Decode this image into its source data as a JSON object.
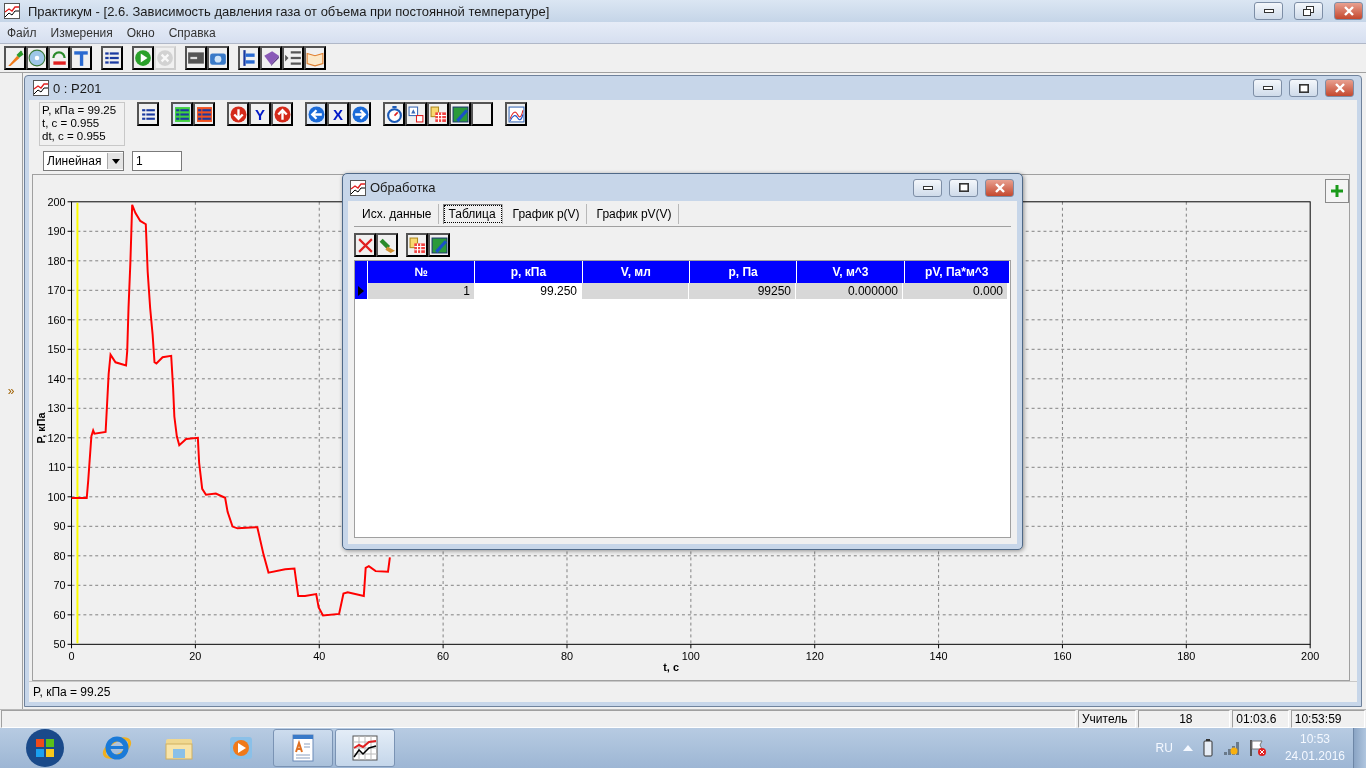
{
  "window": {
    "title": "Практикум - [2.6. Зависимость давления газа от объема при постоянной температуре]"
  },
  "menu": [
    "Файл",
    "Измерения",
    "Окно",
    "Справка"
  ],
  "toolbar": {
    "groups": [
      [
        {
          "kind": "carrot",
          "disabled": false
        },
        {
          "kind": "disc",
          "disabled": false
        },
        {
          "kind": "undo",
          "disabled": false
        },
        {
          "kind": "t-tool",
          "disabled": false
        }
      ],
      [
        {
          "kind": "list",
          "disabled": false
        }
      ],
      [
        {
          "kind": "play",
          "disabled": false
        },
        {
          "kind": "stop",
          "disabled": true
        }
      ],
      [
        {
          "kind": "console",
          "disabled": false
        },
        {
          "kind": "camera",
          "disabled": false
        }
      ],
      [
        {
          "kind": "tree",
          "disabled": false
        },
        {
          "kind": "book",
          "disabled": false
        },
        {
          "kind": "indent",
          "disabled": false
        },
        {
          "kind": "open-book",
          "disabled": false
        }
      ]
    ]
  },
  "side_strip": {
    "expander": "»"
  },
  "child_window": {
    "title": "0 : P201",
    "readings": [
      "P, кПа = 99.25",
      "t, с = 0.955",
      "dt, с = 0.955"
    ],
    "chart_toolbar": {
      "groups": [
        [
          {
            "kind": "list",
            "pressed": false
          }
        ],
        [
          {
            "kind": "checklist",
            "pressed": true
          },
          {
            "kind": "list-filled",
            "pressed": false
          }
        ],
        [
          {
            "kind": "arrow-down",
            "pressed": false
          },
          {
            "kind": "text",
            "label": "Y",
            "pressed": false
          },
          {
            "kind": "arrow-up",
            "pressed": false
          }
        ],
        [
          {
            "kind": "arrow-left",
            "pressed": true
          },
          {
            "kind": "text",
            "label": "X",
            "pressed": false
          },
          {
            "kind": "arrow-right",
            "pressed": false
          }
        ],
        [
          {
            "kind": "stopwatch",
            "pressed": false
          },
          {
            "kind": "image-swap",
            "pressed": false
          },
          {
            "kind": "table",
            "pressed": false
          },
          {
            "kind": "image-edit",
            "pressed": false
          },
          {
            "kind": "blank",
            "pressed": false
          }
        ],
        [
          {
            "kind": "chart",
            "pressed": false
          }
        ]
      ]
    },
    "scale_select": {
      "value": "Линейная"
    },
    "step_field": {
      "value": "1"
    },
    "chart_data": {
      "type": "line",
      "xlabel": "t, с",
      "ylabel": "P, кПа",
      "xlim": [
        0,
        200
      ],
      "ylim": [
        50,
        200
      ],
      "xticks": [
        0,
        20,
        40,
        60,
        80,
        100,
        120,
        140,
        160,
        180,
        200
      ],
      "yticks": [
        50,
        60,
        70,
        80,
        90,
        100,
        110,
        120,
        130,
        140,
        150,
        160,
        170,
        180,
        190,
        200
      ],
      "x": [
        0,
        2.45,
        2.7,
        3.2,
        3.5,
        3.7,
        5.5,
        5.8,
        6.0,
        6.3,
        7.1,
        8.8,
        9.0,
        9.2,
        9.5,
        9.8,
        10.3,
        11.1,
        12.0,
        12.3,
        12.7,
        13.1,
        13.4,
        13.7,
        14.7,
        16.1,
        16.4,
        16.6,
        17.0,
        17.4,
        18.5,
        20.4,
        20.6,
        21.1,
        21.7,
        23.3,
        24.8,
        25.2,
        26.0,
        26.8,
        30.0,
        31.0,
        31.8,
        34.5,
        36.0,
        36.6,
        37.7,
        39.5,
        39.9,
        40.6,
        43.2,
        43.9,
        44.6,
        47.2,
        47.5,
        48.0,
        49.1,
        51.1,
        51.4
      ],
      "series": [
        {
          "color": "#ff0000",
          "values": [
            99.6,
            99.6,
            105.5,
            120.5,
            122.5,
            121.4,
            122,
            134,
            141.7,
            148.2,
            145.6,
            144.5,
            149.5,
            164,
            179.6,
            199,
            196.3,
            193.5,
            192.4,
            176.3,
            164,
            155,
            145.6,
            145.2,
            147.3,
            147.8,
            137.2,
            127.2,
            120.5,
            117.5,
            119.6,
            120,
            111.5,
            102.7,
            100.7,
            101.1,
            99.7,
            94.9,
            89.9,
            89.3,
            89.7,
            80.4,
            74.3,
            75.4,
            75.7,
            66.4,
            66.4,
            67.0,
            62.5,
            59.8,
            60.3,
            67.2,
            67.6,
            66.4,
            75.9,
            76.5,
            74.8,
            74.6,
            79.5
          ]
        }
      ],
      "grid": true,
      "ref_lines": [
        {
          "axis": "x",
          "value": 0.955,
          "color": "#ffff00"
        }
      ]
    },
    "status": "P, кПа = 99.25"
  },
  "dialog": {
    "title": "Обработка",
    "tabs": [
      {
        "label": "Исх. данные",
        "selected": false
      },
      {
        "label": "Таблица",
        "selected": true
      },
      {
        "label": "График p(V)",
        "selected": false
      },
      {
        "label": "График pV(V)",
        "selected": false
      }
    ],
    "toolbar": {
      "groups": [
        [
          {
            "kind": "cross"
          },
          {
            "kind": "brush"
          }
        ],
        [
          {
            "kind": "table"
          },
          {
            "kind": "image-edit"
          }
        ]
      ]
    },
    "table": {
      "columns": [
        "№",
        "p, кПа",
        "V, мл",
        "p, Па",
        "V, м^3",
        "pV, Па*м^3"
      ],
      "rows": [
        {
          "selected": true,
          "cells": [
            {
              "text": "1",
              "editing": false
            },
            {
              "text": "99.250",
              "editing": true
            },
            {
              "editing": false
            },
            {
              "text": "99250",
              "editing": false
            },
            {
              "text": "0.000000",
              "editing": false
            },
            {
              "text": "0.000",
              "editing": false
            }
          ]
        }
      ]
    }
  },
  "status_bar": [
    "Учитель",
    "18",
    "01:03.6",
    "10:53:59"
  ],
  "taskbar": {
    "apps": [
      {
        "kind": "browser",
        "running": false,
        "selected": false
      },
      {
        "kind": "folder",
        "running": false,
        "selected": false
      },
      {
        "kind": "media",
        "running": false,
        "selected": false
      },
      {
        "kind": "document",
        "running": true,
        "selected": false
      },
      {
        "kind": "chart",
        "running": true,
        "selected": true
      }
    ],
    "language": "RU",
    "clock": {
      "time": "10:53",
      "date": "24.01.2016"
    }
  }
}
